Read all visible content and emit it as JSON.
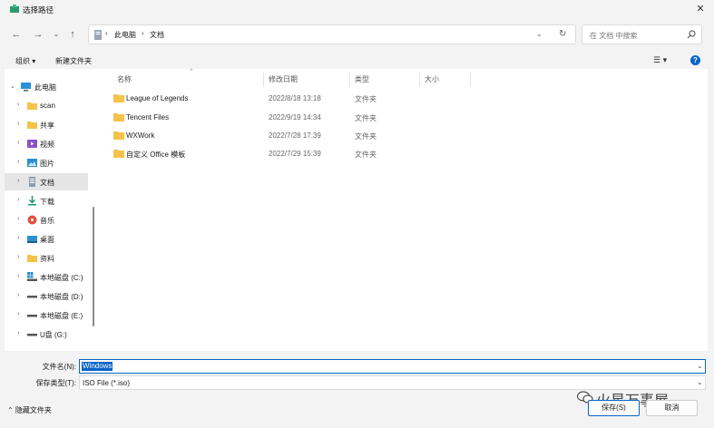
{
  "window": {
    "title": "选择路径",
    "close_glyph": "✕"
  },
  "nav": {
    "back_glyph": "←",
    "forward_glyph": "→",
    "history_glyph": "⌄",
    "up_glyph": "↑",
    "breadcrumbs": [
      "此电脑",
      "文档"
    ],
    "crumb_sep": "›",
    "dropdown_glyph": "⌄",
    "refresh_glyph": "↻",
    "search_placeholder": "在 文档 中搜索"
  },
  "toolbar": {
    "organize_label": "组织 ▾",
    "new_folder_label": "新建文件夹",
    "view_glyph": "☰ ▾",
    "help_glyph": "?"
  },
  "sidebar": {
    "items": [
      {
        "label": "此电脑",
        "icon": "pc-icon"
      },
      {
        "label": "scan",
        "icon": "folder-icon"
      },
      {
        "label": "共享",
        "icon": "folder-icon"
      },
      {
        "label": "视频",
        "icon": "video-icon"
      },
      {
        "label": "图片",
        "icon": "picture-icon"
      },
      {
        "label": "文档",
        "icon": "document-icon"
      },
      {
        "label": "下载",
        "icon": "download-icon"
      },
      {
        "label": "音乐",
        "icon": "music-icon"
      },
      {
        "label": "桌面",
        "icon": "desktop-icon"
      },
      {
        "label": "资料",
        "icon": "folder-icon"
      },
      {
        "label": "本地磁盘 (C:)",
        "icon": "system-drive-icon"
      },
      {
        "label": "本地磁盘 (D:)",
        "icon": "drive-icon"
      },
      {
        "label": "本地磁盘 (E:)",
        "icon": "drive-icon"
      },
      {
        "label": "U盘 (G:)",
        "icon": "usb-drive-icon"
      }
    ],
    "chevron_right": "›",
    "chevron_down": "⌄"
  },
  "files": {
    "columns": [
      "名称",
      "修改日期",
      "类型",
      "大小"
    ],
    "sort_glyph": "⌃",
    "rows": [
      {
        "name": "League of Legends",
        "date": "2022/8/18 13:18",
        "type": "文件夹"
      },
      {
        "name": "Tencent Files",
        "date": "2022/9/19 14:34",
        "type": "文件夹"
      },
      {
        "name": "WXWork",
        "date": "2022/7/28 17:39",
        "type": "文件夹"
      },
      {
        "name": "自定义 Office 模板",
        "date": "2022/7/29 15:39",
        "type": "文件夹"
      }
    ]
  },
  "form": {
    "filename_label": "文件名(N):",
    "filename_value": "Windows",
    "filetype_label": "保存类型(T):",
    "filetype_value": "ISO File (*.iso)",
    "dropdown_glyph": "⌄"
  },
  "footer": {
    "hide_folders_label": "⌃ 隐藏文件夹",
    "save_label": "保存(S)",
    "cancel_label": "取消",
    "watermark": "火星万事屋"
  },
  "colors": {
    "accent": "#0a64c8",
    "folder": "#f5c24a",
    "selected_bg": "#e5e5e5"
  }
}
